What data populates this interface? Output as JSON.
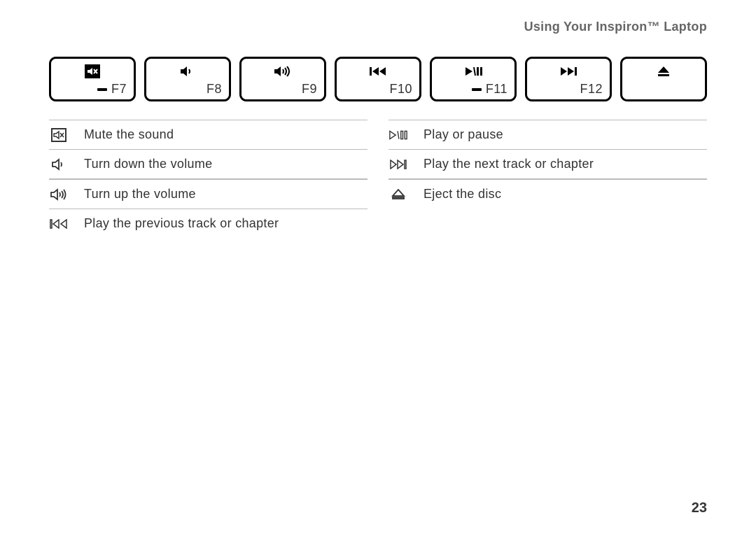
{
  "header": "Using Your Inspiron™ Laptop",
  "pageNumber": "23",
  "keys": [
    {
      "icon": "mute",
      "label": "F7",
      "dash": true
    },
    {
      "icon": "vol-down",
      "label": "F8",
      "dash": false
    },
    {
      "icon": "vol-up",
      "label": "F9",
      "dash": false
    },
    {
      "icon": "prev",
      "label": "F10",
      "dash": false
    },
    {
      "icon": "play-pause",
      "label": "F11",
      "dash": true
    },
    {
      "icon": "next",
      "label": "F12",
      "dash": false
    },
    {
      "icon": "eject",
      "label": "",
      "dash": false
    }
  ],
  "legendLeft": [
    {
      "icon": "mute-outline",
      "text": "Mute the sound"
    },
    {
      "icon": "vol-down-outline",
      "text": "Turn down the volume"
    },
    {
      "icon": "vol-up-outline",
      "text": "Turn up the volume"
    },
    {
      "icon": "prev-outline",
      "text": "Play the previous track or chapter"
    }
  ],
  "legendRight": [
    {
      "icon": "play-pause-outline",
      "text": "Play or pause"
    },
    {
      "icon": "next-outline",
      "text": "Play the next track or chapter"
    },
    {
      "icon": "eject-outline",
      "text": "Eject the disc"
    }
  ]
}
